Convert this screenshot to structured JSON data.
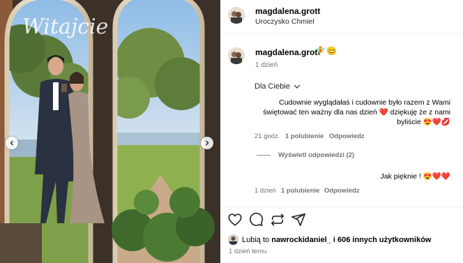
{
  "post": {
    "author": "magdalena.grott",
    "location": "Uroczysko Chmiel",
    "photo_script_text": "Witajcie"
  },
  "caption": {
    "author": "magdalena.grott",
    "emojis": [
      "🧚",
      "😊"
    ],
    "time": "1 dzień"
  },
  "comments_filter": {
    "label": "Dla Ciebie"
  },
  "comments": [
    {
      "text": "Cudownie wyglądałaś i cudownie było razem z Wami świętować ten ważny dla nas dzień ❤️ dziękuję że z nami byliście 😍❤️💋",
      "time": "21 godz.",
      "likes": "1 polubienie",
      "reply": "Odpowiedz",
      "view_replies": "Wyświetl odpowiedzi (2)"
    },
    {
      "text": "Jak pięknie ! 😍❤️❤️",
      "time": "1 dzień",
      "likes": "1 polubienie",
      "reply": "Odpowiedz"
    }
  ],
  "actions": {
    "icons": [
      "heart-icon",
      "comment-icon",
      "repost-icon",
      "share-icon"
    ]
  },
  "likes": {
    "prefix": "Lubią to",
    "user": "nawrockidaniel_",
    "suffix": "i 606 innych użytkowników"
  },
  "post_time": "1 dzień temu",
  "colors": {
    "secondary_text": "#737373",
    "border": "#efefef",
    "heart": "#ed4956"
  }
}
